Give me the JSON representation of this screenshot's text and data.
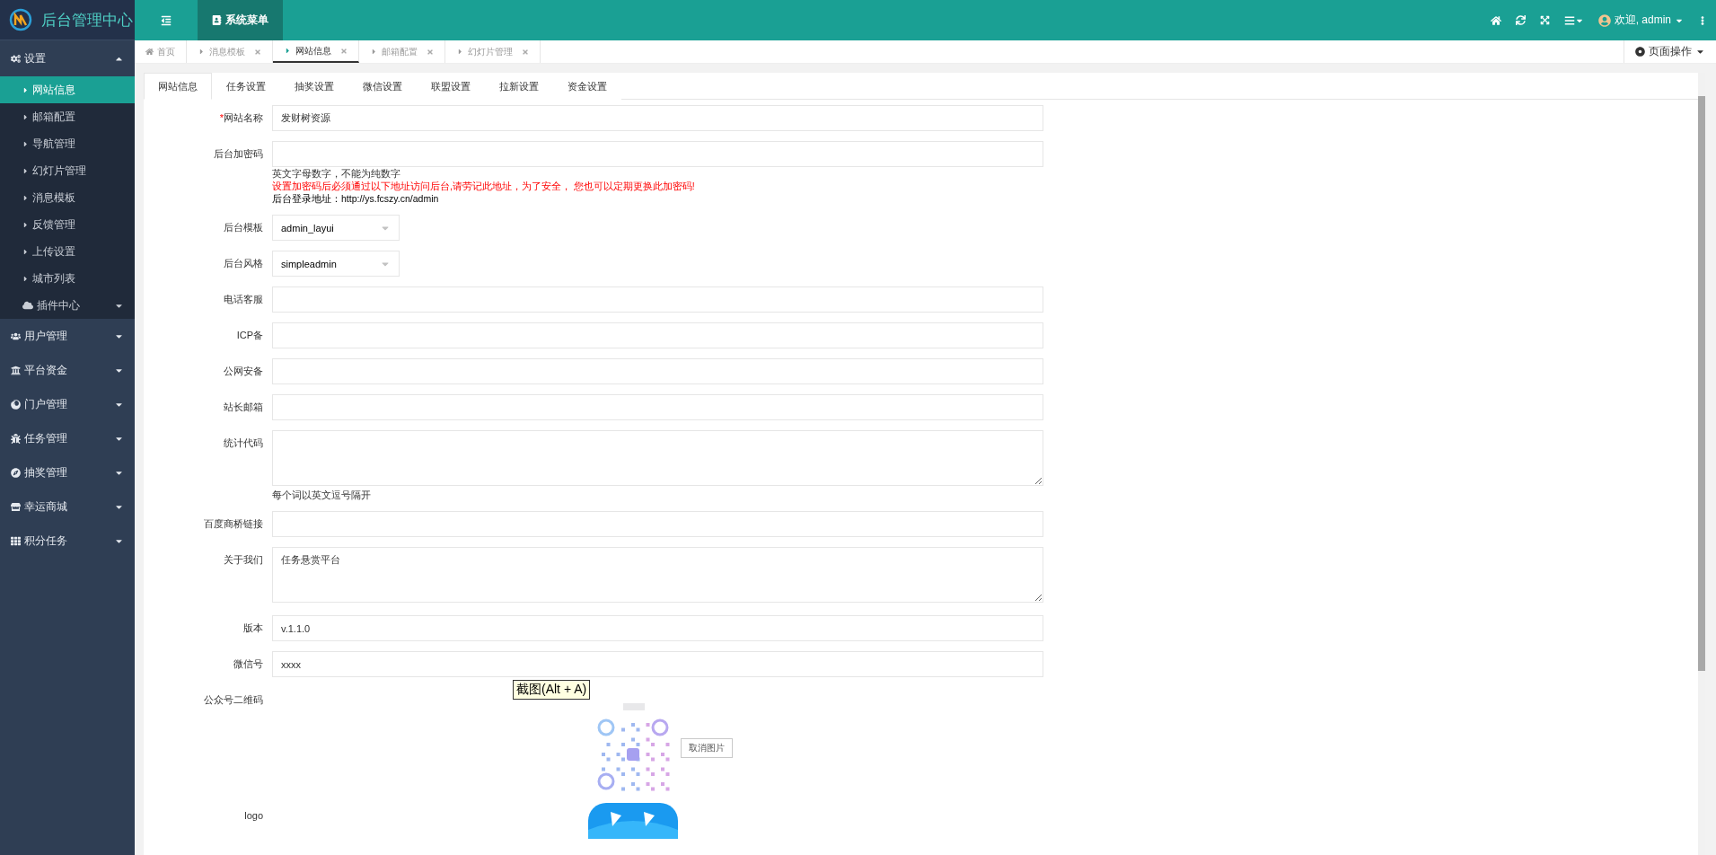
{
  "brand": {
    "title": "后台管理中心"
  },
  "topbar": {
    "menu_tab": "系统菜单",
    "user": "欢迎, admin"
  },
  "sidebar": [
    {
      "label": "设置",
      "expanded": true,
      "children": [
        {
          "label": "网站信息",
          "selected": true
        },
        {
          "label": "邮箱配置",
          "selected": false
        },
        {
          "label": "导航管理",
          "selected": false
        },
        {
          "label": "幻灯片管理",
          "selected": false
        },
        {
          "label": "消息模板",
          "selected": false
        },
        {
          "label": "反馈管理",
          "selected": false
        },
        {
          "label": "上传设置",
          "selected": false
        },
        {
          "label": "城市列表",
          "selected": false
        },
        {
          "label": "插件中心",
          "selected": false,
          "kind": "group",
          "expanded": false
        }
      ]
    },
    {
      "label": "用户管理",
      "expanded": false
    },
    {
      "label": "平台资金",
      "expanded": false
    },
    {
      "label": "门户管理",
      "expanded": false
    },
    {
      "label": "任务管理",
      "expanded": false
    },
    {
      "label": "抽奖管理",
      "expanded": false
    },
    {
      "label": "幸运商城",
      "expanded": false
    },
    {
      "label": "积分任务",
      "expanded": false
    }
  ],
  "page_tabs": [
    {
      "label": "首页",
      "kind": "home",
      "selected": false
    },
    {
      "label": "消息模板",
      "kind": "page",
      "selected": false
    },
    {
      "label": "网站信息",
      "kind": "page",
      "selected": true
    },
    {
      "label": "邮箱配置",
      "kind": "page",
      "selected": false
    },
    {
      "label": "幻灯片管理",
      "kind": "page",
      "selected": false
    }
  ],
  "page_actions": "页面操作",
  "form_tabs": [
    {
      "label": "网站信息",
      "selected": true
    },
    {
      "label": "任务设置",
      "selected": false
    },
    {
      "label": "抽奖设置",
      "selected": false
    },
    {
      "label": "微信设置",
      "selected": false
    },
    {
      "label": "联盟设置",
      "selected": false
    },
    {
      "label": "拉新设置",
      "selected": false
    },
    {
      "label": "资金设置",
      "selected": false
    }
  ],
  "fields": [
    {
      "label": "网站名称",
      "required_mark": "*",
      "kind": "input",
      "value": "发财树资源"
    },
    {
      "label": "后台加密码",
      "kind": "input",
      "hints": [
        {
          "text": "英文字母数字，不能为纯数字",
          "kind": "note"
        },
        {
          "text": "设置加密码后必须通过以下地址访问后台,请劳记此地址，为了安全， 您也可以定期更换此加密码!",
          "kind": "warning"
        },
        {
          "text": "后台登录地址：http://ys.fcszy.cn/admin",
          "kind": "address"
        }
      ]
    },
    {
      "label": "后台模板",
      "kind": "select",
      "value": "admin_layui"
    },
    {
      "label": "后台风格",
      "kind": "select",
      "value": "simpleadmin"
    },
    {
      "label": "电话客服",
      "kind": "input"
    },
    {
      "label": "ICP备",
      "kind": "input"
    },
    {
      "label": "公网安备",
      "kind": "input"
    },
    {
      "label": "站长邮箱",
      "kind": "input"
    },
    {
      "label": "统计代码",
      "kind": "textarea",
      "hints": [
        {
          "text": "每个词以英文逗号隔开",
          "kind": "note"
        }
      ]
    },
    {
      "label": "百度商桥链接",
      "kind": "input"
    },
    {
      "label": "关于我们",
      "kind": "textarea",
      "value": "任务悬赏平台"
    },
    {
      "label": "版本",
      "kind": "input",
      "value": "v.1.1.0"
    },
    {
      "label": "微信号",
      "kind": "input",
      "value": "xxxx"
    },
    {
      "label": "公众号二维码",
      "kind": "qrcode",
      "button": "取消图片",
      "tooltip": "截图(Alt + A)"
    },
    {
      "label": "logo",
      "kind": "logo"
    }
  ]
}
